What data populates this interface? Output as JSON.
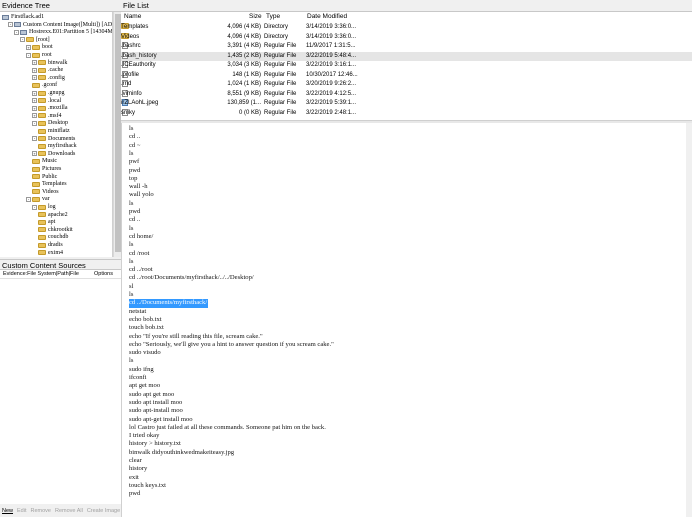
{
  "panes": {
    "evidence_tree": "Evidence Tree",
    "file_list": "File List",
    "custom_sources": "Custom Content Sources"
  },
  "tree": [
    {
      "label": "Firstflack.ad1",
      "indent": 0,
      "icon": "disk",
      "toggle": ""
    },
    {
      "label": "Custom Content Image([Multi]) [AD1]",
      "indent": 1,
      "icon": "disk",
      "toggle": "-"
    },
    {
      "label": "Hostrexx.E01:Partition 5 [14304MB]",
      "indent": 2,
      "icon": "disk",
      "toggle": "-"
    },
    {
      "label": "[root]",
      "indent": 3,
      "icon": "folder",
      "toggle": "-"
    },
    {
      "label": "boot",
      "indent": 4,
      "icon": "folder",
      "toggle": "+"
    },
    {
      "label": "root",
      "indent": 4,
      "icon": "folder",
      "toggle": "-"
    },
    {
      "label": "binwalk",
      "indent": 5,
      "icon": "folder",
      "toggle": "+"
    },
    {
      "label": ".cache",
      "indent": 5,
      "icon": "folder",
      "toggle": "+"
    },
    {
      "label": ".config",
      "indent": 5,
      "icon": "folder",
      "toggle": "+"
    },
    {
      "label": ".gconf",
      "indent": 5,
      "icon": "folder",
      "toggle": ""
    },
    {
      "label": ".gnupg",
      "indent": 5,
      "icon": "folder",
      "toggle": "+"
    },
    {
      "label": ".local",
      "indent": 5,
      "icon": "folder",
      "toggle": "+"
    },
    {
      "label": ".mozilla",
      "indent": 5,
      "icon": "folder",
      "toggle": "+"
    },
    {
      "label": ".msf4",
      "indent": 5,
      "icon": "folder",
      "toggle": "+"
    },
    {
      "label": "Desktop",
      "indent": 5,
      "icon": "folder",
      "toggle": "-"
    },
    {
      "label": "miniflatz",
      "indent": 6,
      "icon": "folder",
      "toggle": ""
    },
    {
      "label": "Documents",
      "indent": 5,
      "icon": "folder",
      "toggle": "-"
    },
    {
      "label": "myfirsthack",
      "indent": 6,
      "icon": "folder",
      "toggle": ""
    },
    {
      "label": "Downloads",
      "indent": 5,
      "icon": "folder",
      "toggle": "+"
    },
    {
      "label": "Music",
      "indent": 5,
      "icon": "folder",
      "toggle": ""
    },
    {
      "label": "Pictures",
      "indent": 5,
      "icon": "folder",
      "toggle": ""
    },
    {
      "label": "Public",
      "indent": 5,
      "icon": "folder",
      "toggle": ""
    },
    {
      "label": "Templates",
      "indent": 5,
      "icon": "folder",
      "toggle": ""
    },
    {
      "label": "Videos",
      "indent": 5,
      "icon": "folder",
      "toggle": ""
    },
    {
      "label": "var",
      "indent": 4,
      "icon": "folder",
      "toggle": "-"
    },
    {
      "label": "log",
      "indent": 5,
      "icon": "folder",
      "toggle": "-"
    },
    {
      "label": "apache2",
      "indent": 6,
      "icon": "folder",
      "toggle": ""
    },
    {
      "label": "apt",
      "indent": 6,
      "icon": "folder",
      "toggle": ""
    },
    {
      "label": "chkrootkit",
      "indent": 6,
      "icon": "folder",
      "toggle": ""
    },
    {
      "label": "couchdb",
      "indent": 6,
      "icon": "folder",
      "toggle": ""
    },
    {
      "label": "dradis",
      "indent": 6,
      "icon": "folder",
      "toggle": ""
    },
    {
      "label": "exim4",
      "indent": 6,
      "icon": "folder",
      "toggle": ""
    }
  ],
  "ccs": {
    "col1": "Evidence:File System|Path|File",
    "col2": "Options",
    "buttons": [
      {
        "label": "New",
        "enabled": true
      },
      {
        "label": "Edit",
        "enabled": false
      },
      {
        "label": "Remove",
        "enabled": false
      },
      {
        "label": "Remove All",
        "enabled": false
      },
      {
        "label": "Create Image",
        "enabled": false
      }
    ]
  },
  "filelist": {
    "columns": {
      "name": "Name",
      "size": "Size",
      "type": "Type",
      "date": "Date Modified"
    },
    "rows": [
      {
        "name": "Templates",
        "size": "4,096 (4 KB)",
        "type": "Directory",
        "date": "3/14/2019 3:36:0...",
        "icon": "folder",
        "selected": false
      },
      {
        "name": "Videos",
        "size": "4,096 (4 KB)",
        "type": "Directory",
        "date": "3/14/2019 3:36:0...",
        "icon": "folder",
        "selected": false
      },
      {
        "name": ".bashrc",
        "size": "3,391 (4 KB)",
        "type": "Regular File",
        "date": "11/9/2017 1:31:5...",
        "icon": "file",
        "selected": false
      },
      {
        "name": ".bash_history",
        "size": "1,435 (2 KB)",
        "type": "Regular File",
        "date": "3/22/2019 5:48:4...",
        "icon": "file",
        "selected": true
      },
      {
        "name": ".ICEauthority",
        "size": "3,034 (3 KB)",
        "type": "Regular File",
        "date": "3/22/2019 3:16:1...",
        "icon": "file",
        "selected": false
      },
      {
        "name": ".profile",
        "size": "148 (1 KB)",
        "type": "Regular File",
        "date": "10/30/2017 12:46...",
        "icon": "file",
        "selected": false
      },
      {
        "name": ".rnd",
        "size": "1,024 (1 KB)",
        "type": "Regular File",
        "date": "3/20/2019 9:26:2...",
        "icon": "file",
        "selected": false
      },
      {
        "name": ".viminfo",
        "size": "8,551 (9 KB)",
        "type": "Regular File",
        "date": "3/22/2019 4:12:5...",
        "icon": "file",
        "selected": false
      },
      {
        "name": "irZLAohL.jpeg",
        "size": "130,859 (1...",
        "type": "Regular File",
        "date": "3/22/2019 5:39:1...",
        "icon": "image",
        "selected": false
      },
      {
        "name": "sníky",
        "size": "0 (0 KB)",
        "type": "Regular File",
        "date": "3/22/2019 2:48:1...",
        "icon": "file",
        "selected": false
      }
    ]
  },
  "viewer_lines": [
    {
      "text": "ls",
      "highlight": false
    },
    {
      "text": "cd ..",
      "highlight": false
    },
    {
      "text": "cd ~",
      "highlight": false
    },
    {
      "text": "ls",
      "highlight": false
    },
    {
      "text": "pwf",
      "highlight": false
    },
    {
      "text": "pwd",
      "highlight": false
    },
    {
      "text": "top",
      "highlight": false
    },
    {
      "text": "wall -h",
      "highlight": false
    },
    {
      "text": "wall yolo",
      "highlight": false
    },
    {
      "text": "ls",
      "highlight": false
    },
    {
      "text": "pwd",
      "highlight": false
    },
    {
      "text": "cd ..",
      "highlight": false
    },
    {
      "text": "ls",
      "highlight": false
    },
    {
      "text": "cd home/",
      "highlight": false
    },
    {
      "text": "ls",
      "highlight": false
    },
    {
      "text": "cd /root",
      "highlight": false
    },
    {
      "text": "ls",
      "highlight": false
    },
    {
      "text": "cd ../root",
      "highlight": false
    },
    {
      "text": "cd ../root/Documents/myfirsthack/../../Desktop/",
      "highlight": false
    },
    {
      "text": "sl",
      "highlight": false
    },
    {
      "text": "ls",
      "highlight": false
    },
    {
      "text": "cd ../Documents/myfirsthack/",
      "highlight": true
    },
    {
      "text": "netstat",
      "highlight": false
    },
    {
      "text": "echo bob.txt",
      "highlight": false
    },
    {
      "text": "touch bob.txt",
      "highlight": false
    },
    {
      "text": "echo \"If you're still reading this file, scream cake.\"",
      "highlight": false
    },
    {
      "text": "echo \"Seriously, we'll give you a hint to answer question if you scream cake.\"",
      "highlight": false
    },
    {
      "text": "sudo visudo",
      "highlight": false
    },
    {
      "text": "ls",
      "highlight": false
    },
    {
      "text": "sudo ifng",
      "highlight": false
    },
    {
      "text": "ifconfi",
      "highlight": false
    },
    {
      "text": "apt get moo",
      "highlight": false
    },
    {
      "text": "sudo apt get moo",
      "highlight": false
    },
    {
      "text": "sudo apt install moo",
      "highlight": false
    },
    {
      "text": "sudo apt-install moo",
      "highlight": false
    },
    {
      "text": "sudo apt-get install moo",
      "highlight": false
    },
    {
      "text": "lol Castro just failed at all these commands. Someone pat him on the back.",
      "highlight": false
    },
    {
      "text": "I tried okay",
      "highlight": false
    },
    {
      "text": "history > history.txt",
      "highlight": false
    },
    {
      "text": "binwalk didyouthinkwedmakeiteasy.jpg",
      "highlight": false
    },
    {
      "text": "clear",
      "highlight": false
    },
    {
      "text": "history",
      "highlight": false
    },
    {
      "text": "exit",
      "highlight": false
    },
    {
      "text": "touch keys.txt",
      "highlight": false
    },
    {
      "text": "pwd",
      "highlight": false
    }
  ]
}
